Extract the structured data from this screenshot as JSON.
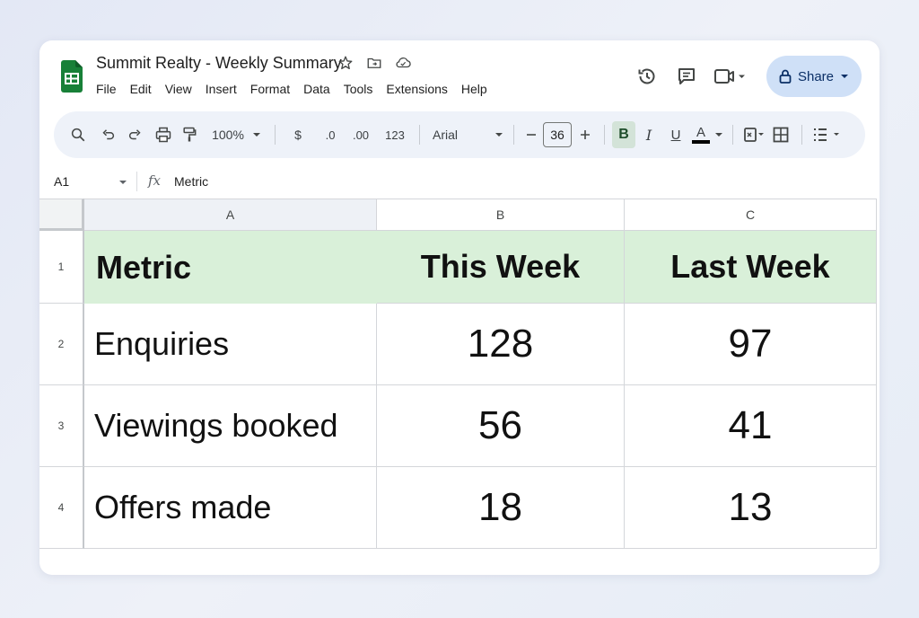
{
  "document": {
    "title": "Summit Realty - Weekly Summary"
  },
  "menu": [
    "File",
    "Edit",
    "View",
    "Insert",
    "Format",
    "Data",
    "Tools",
    "Extensions",
    "Help"
  ],
  "share": {
    "label": "Share"
  },
  "toolbar": {
    "zoom": "100%",
    "currency": "$",
    "decimal_decrease": ".0",
    "decimal_increase": ".00",
    "number_format": "123",
    "font": "Arial",
    "font_size": "36",
    "bold": "B",
    "italic": "I",
    "underline": "U",
    "text_color": "A"
  },
  "formula_bar": {
    "cell_ref": "A1",
    "fx": "fx",
    "content": "Metric"
  },
  "columns": [
    "A",
    "B",
    "C"
  ],
  "rows": [
    {
      "num": "1",
      "cells": [
        "Metric",
        "This Week",
        "Last Week"
      ]
    },
    {
      "num": "2",
      "cells": [
        "Enquiries",
        "128",
        "97"
      ]
    },
    {
      "num": "3",
      "cells": [
        "Viewings booked",
        "56",
        "41"
      ]
    },
    {
      "num": "4",
      "cells": [
        "Offers made",
        "18",
        "13"
      ]
    }
  ],
  "colors": {
    "header_fill": "#d9f0d9",
    "share_button": "#cfe0f7",
    "toolbar_bg": "#eef2f9",
    "brand_green": "#188038"
  },
  "icons": [
    "sheets-logo-icon",
    "star-icon",
    "move-folder-icon",
    "cloud-status-icon",
    "history-icon",
    "comment-icon",
    "video-call-icon",
    "lock-icon",
    "search-icon",
    "undo-icon",
    "redo-icon",
    "print-icon",
    "paint-format-icon",
    "fill-color-icon",
    "borders-icon",
    "align-icon"
  ]
}
